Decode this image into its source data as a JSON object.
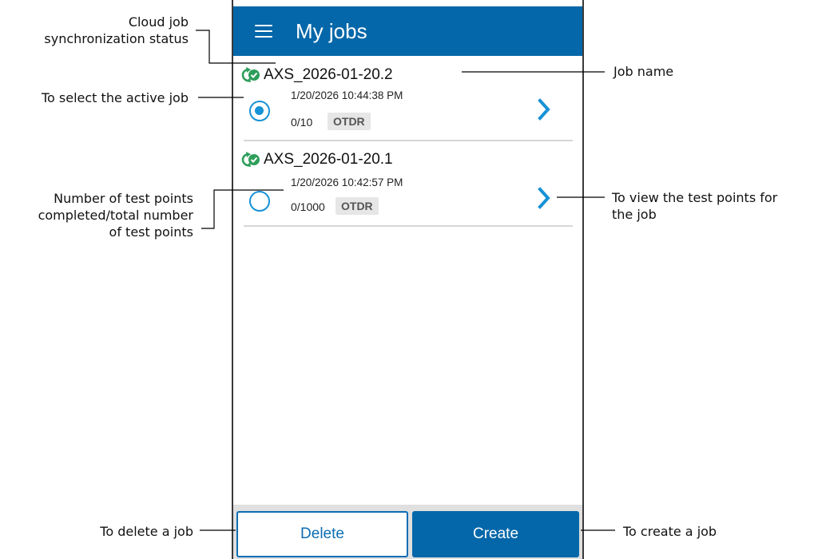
{
  "app": {
    "title": "My jobs",
    "menu_icon": "hamburger-menu-icon"
  },
  "jobs": [
    {
      "name": "AXS_2026-01-20.2",
      "date": "1/20/2026 10:44:38 PM",
      "count": "0/10",
      "type": "OTDR",
      "selected": true,
      "sync_icon": "cloud-sync-check-icon"
    },
    {
      "name": "AXS_2026-01-20.1",
      "date": "1/20/2026 10:42:57 PM",
      "count": "0/1000",
      "type": "OTDR",
      "selected": false,
      "sync_icon": "cloud-sync-check-icon"
    }
  ],
  "buttons": {
    "delete": "Delete",
    "create": "Create"
  },
  "callouts": {
    "sync_status_line1": "Cloud job",
    "sync_status_line2": "synchronization status",
    "select_active": "To select the active job",
    "test_points_line1": "Number of test points",
    "test_points_line2": "completed/total number",
    "test_points_line3": "of test points",
    "delete": "To delete a job",
    "job_name": "Job name",
    "view_points_line1": "To view the test points for",
    "view_points_line2": "the job",
    "create": "To create a job"
  },
  "colors": {
    "appbar": "#0467a9",
    "accent": "#1792d6",
    "sync_green": "#2e9e5b"
  }
}
